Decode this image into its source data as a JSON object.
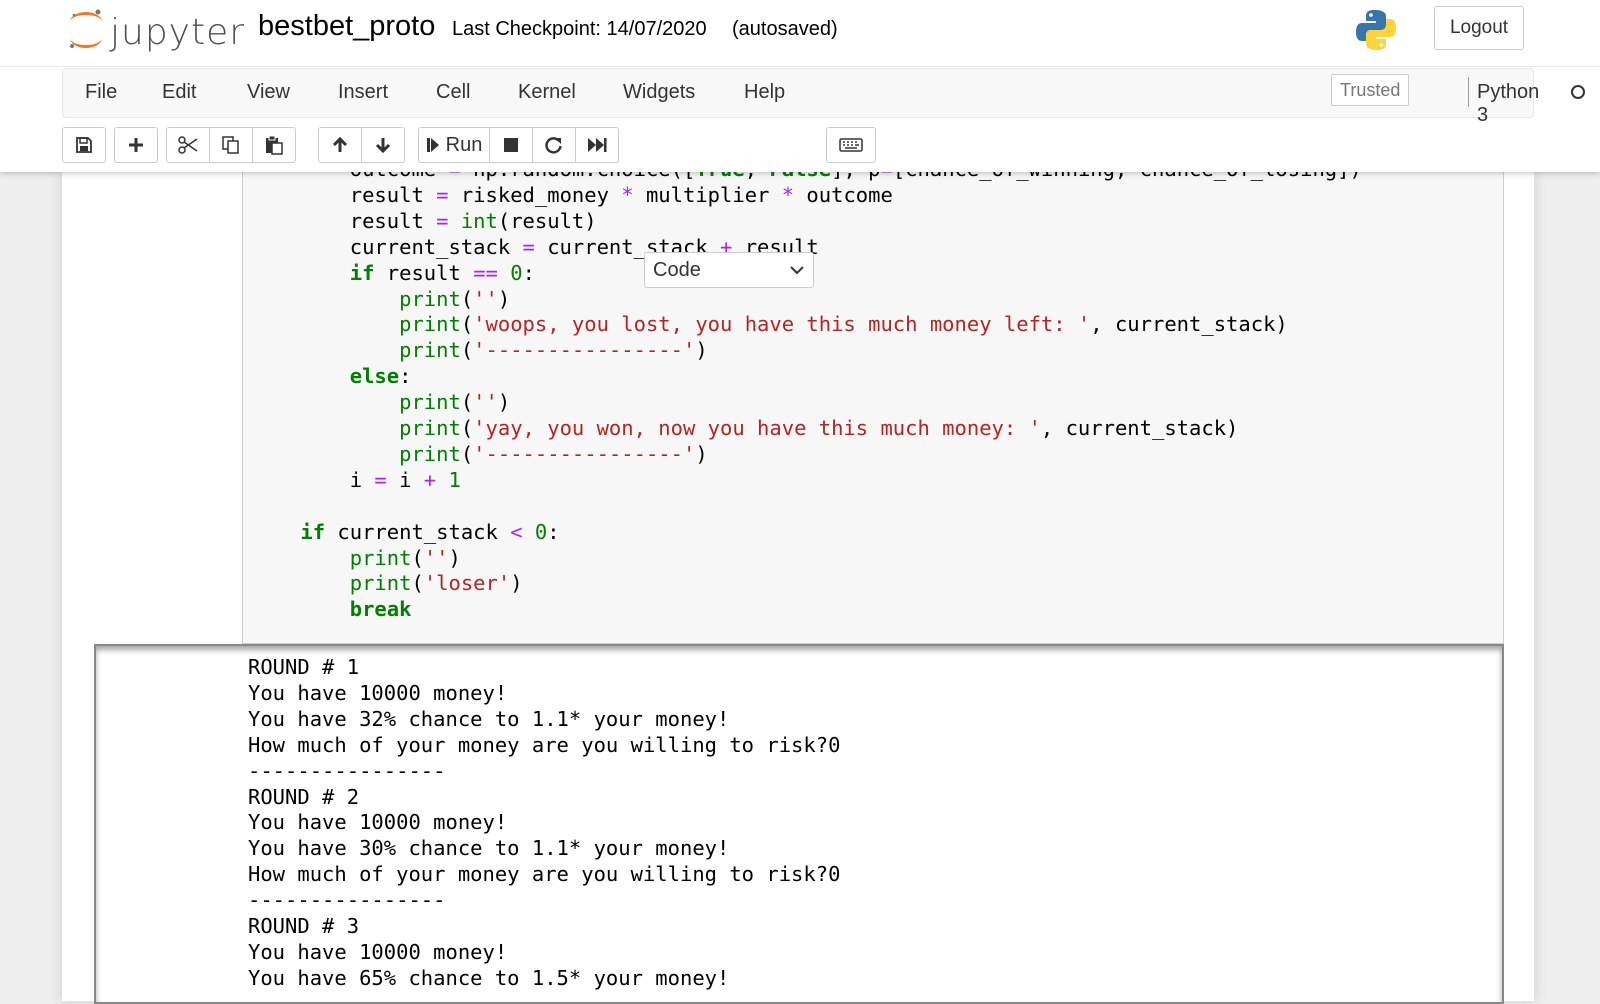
{
  "header": {
    "logo_text": "jupyter",
    "notebook_name": "bestbet_proto",
    "checkpoint": "Last Checkpoint: 14/07/2020",
    "autosave": "(autosaved)",
    "logout_label": "Logout"
  },
  "menubar": {
    "items": [
      "File",
      "Edit",
      "View",
      "Insert",
      "Cell",
      "Kernel",
      "Widgets",
      "Help"
    ],
    "trusted": "Trusted",
    "kernel_name": "Python 3"
  },
  "toolbar": {
    "run_label": "Run",
    "cell_type": "Code"
  },
  "code_lines": [
    "        outcome = np.random.choice([True, False], p=[chance_of_winning, chance_of_losing])",
    "        result = risked_money * multiplier * outcome",
    "        result = int(result)",
    "        current_stack = current_stack + result",
    "        if result == 0:",
    "            print('')",
    "            print('woops, you lost, you have this much money left: ', current_stack)",
    "            print('----------------')",
    "        else:",
    "            print('')",
    "            print('yay, you won, now you have this much money: ', current_stack)",
    "            print('----------------')",
    "        i = i + 1",
    "",
    "    if current_stack < 0:",
    "        print('')",
    "        print('loser')",
    "        break"
  ],
  "output_lines": [
    "ROUND # 1",
    "You have 10000 money!",
    "You have 32% chance to 1.1* your money!",
    "How much of your money are you willing to risk?0",
    "----------------",
    "ROUND # 2",
    "You have 10000 money!",
    "You have 30% chance to 1.1* your money!",
    "How much of your money are you willing to risk?0",
    "----------------",
    "ROUND # 3",
    "You have 10000 money!",
    "You have 65% chance to 1.5* your money!"
  ]
}
